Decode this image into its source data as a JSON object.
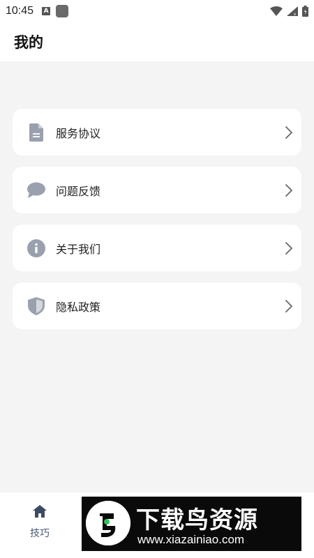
{
  "status_bar": {
    "time": "10:45",
    "a_badge": "A",
    "icons": [
      "a-icon",
      "app-square-icon",
      "wifi-icon",
      "signal-icon",
      "battery-icon"
    ]
  },
  "header": {
    "title": "我的"
  },
  "menu": {
    "items": [
      {
        "label": "服务协议",
        "icon": "document-icon"
      },
      {
        "label": "问题反馈",
        "icon": "chat-bubble-icon"
      },
      {
        "label": "关于我们",
        "icon": "info-icon"
      },
      {
        "label": "隐私政策",
        "icon": "shield-icon"
      }
    ]
  },
  "bottom_nav": {
    "items": [
      {
        "label": "技巧",
        "icon": "home-icon"
      }
    ]
  },
  "watermark": {
    "title": "下载鸟资源",
    "url": "www.xiazainiao.com"
  },
  "colors": {
    "icon_gray": "#9aa0ad",
    "background": "#f4f4f4",
    "nav_blue": "#3d4a63"
  }
}
